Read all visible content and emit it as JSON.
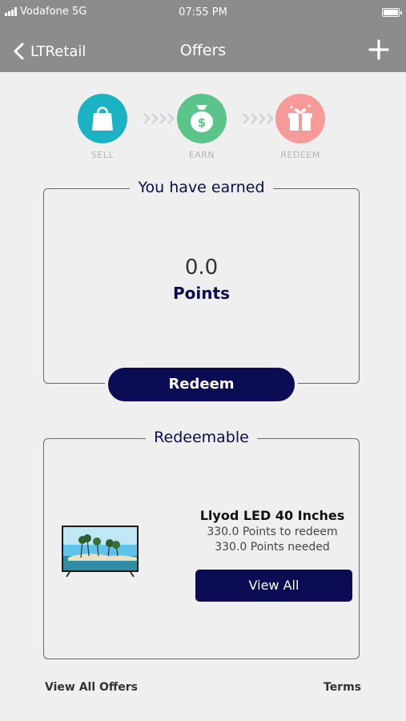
{
  "status_bar": {
    "carrier": "Vodafone 5G",
    "time": "07:55 PM"
  },
  "header": {
    "back_label": "LTRetail",
    "title": "Offers",
    "add_icon": "plus-icon"
  },
  "steps": [
    {
      "label": "SELL",
      "icon": "shopping-bag-icon",
      "color": "#1bb3c3"
    },
    {
      "label": "EARN",
      "icon": "money-bag-icon",
      "color": "#5bc48a"
    },
    {
      "label": "REDEEM",
      "icon": "gift-icon",
      "color": "#f79a9a"
    }
  ],
  "earned": {
    "title": "You have earned",
    "points_value": "0.0",
    "points_label": "Points",
    "redeem_label": "Redeem"
  },
  "redeemable": {
    "title": "Redeemable",
    "product_name": "Llyod LED 40 Inches",
    "points_to_redeem": "330.0 Points to redeem",
    "points_needed": "330.0 Points needed",
    "view_all_label": "View All"
  },
  "footer": {
    "view_all_offers": "View All Offers",
    "terms": "Terms"
  },
  "colors": {
    "header_bg": "#8c8c8c",
    "primary_button": "#0c0c54",
    "heading_text": "#0c0c4e"
  }
}
